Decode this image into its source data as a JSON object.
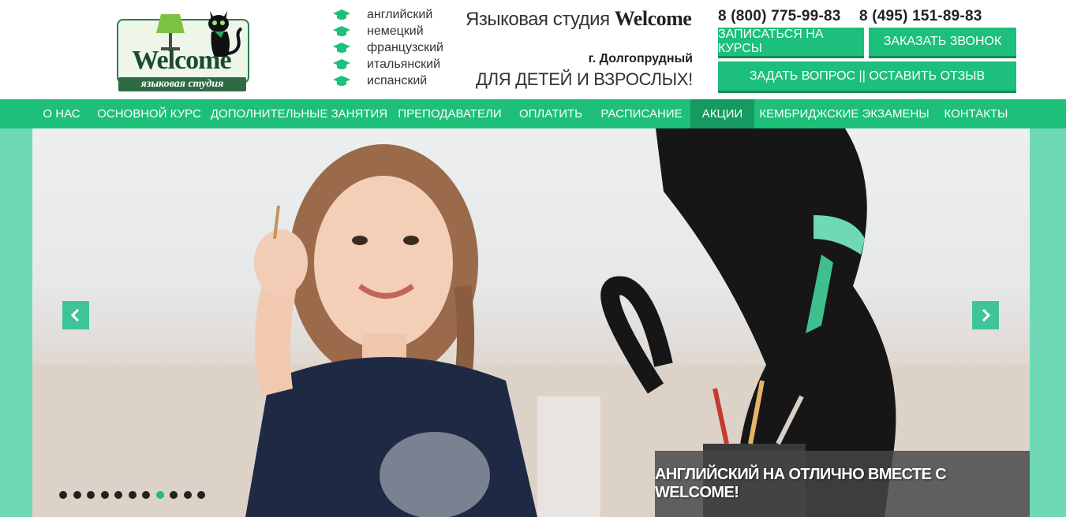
{
  "logo": {
    "word": "Welcome",
    "subtitle": "языковая студия"
  },
  "languages": [
    "английский",
    "немецкий",
    "французский",
    "итальянский",
    "испанский"
  ],
  "studio": {
    "prefix": "Языковая студия ",
    "name": "Welcome"
  },
  "city": "г. Долгопрудный",
  "audience": "ДЛЯ ДЕТЕЙ И ВЗРОСЛЫХ!",
  "phones": [
    "8 (800) 775-99-83",
    "8 (495) 151-89-83"
  ],
  "buttons": {
    "signup": "ЗАПИСАТЬСЯ НА КУРСЫ",
    "callback": "ЗАКАЗАТЬ ЗВОНОК",
    "question": "ЗАДАТЬ ВОПРОС || ОСТАВИТЬ ОТЗЫВ"
  },
  "nav": [
    "О НАС",
    "ОСНОВНОЙ КУРС",
    "ДОПОЛНИТЕЛЬНЫЕ ЗАНЯТИЯ",
    "ПРЕПОДАВАТЕЛИ",
    "ОПЛАТИТЬ",
    "РАСПИСАНИЕ",
    "АКЦИИ",
    "КЕМБРИДЖСКИЕ ЭКЗАМЕНЫ",
    "КОНТАКТЫ"
  ],
  "nav_active": "АКЦИИ",
  "slider": {
    "caption": "АНГЛИЙСКИЙ НА ОТЛИЧНО ВМЕСТЕ С WELCOME!",
    "dot_count": 11,
    "active_dot": 8
  },
  "colors": {
    "accent": "#1cbf7b",
    "nav_active": "#159a61",
    "slider_bg": "#6fd9b6"
  }
}
